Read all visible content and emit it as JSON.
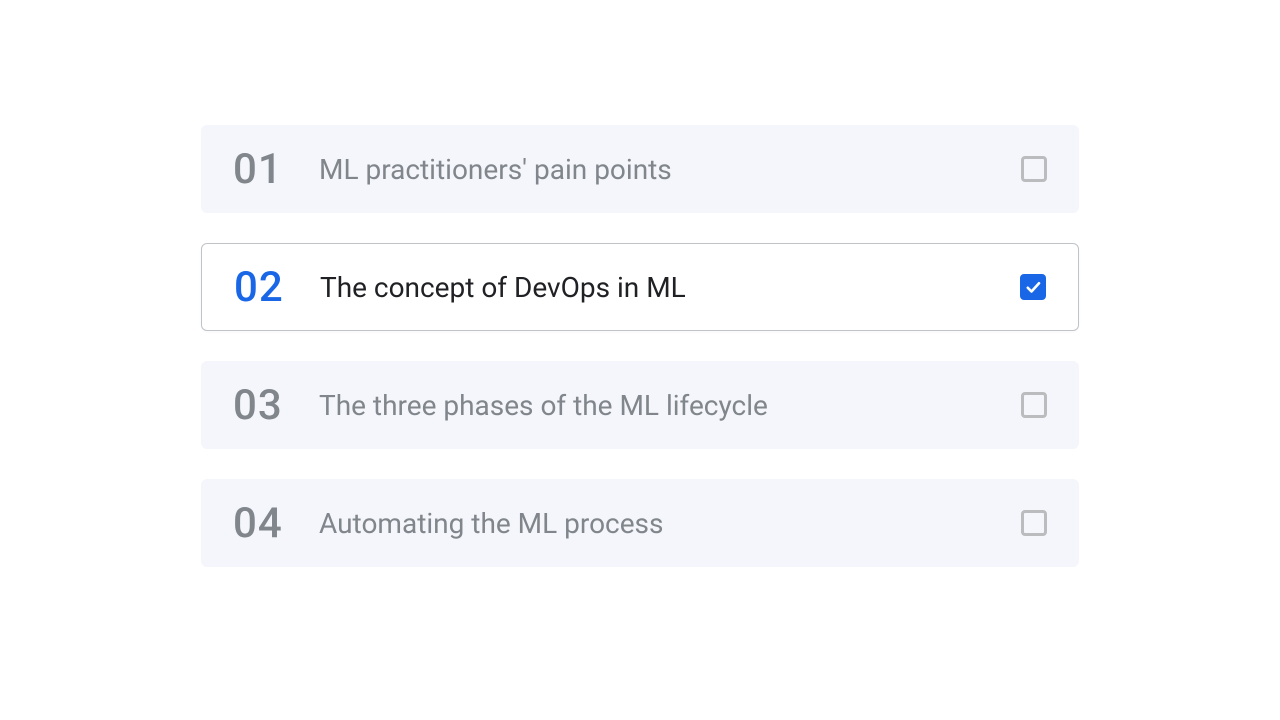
{
  "topics": [
    {
      "num": "01",
      "label": "ML practitioners' pain points",
      "selected": false
    },
    {
      "num": "02",
      "label": "The concept of DevOps in ML",
      "selected": true
    },
    {
      "num": "03",
      "label": "The three phases of the ML lifecycle",
      "selected": false
    },
    {
      "num": "04",
      "label": "Automating the ML process",
      "selected": false
    }
  ]
}
